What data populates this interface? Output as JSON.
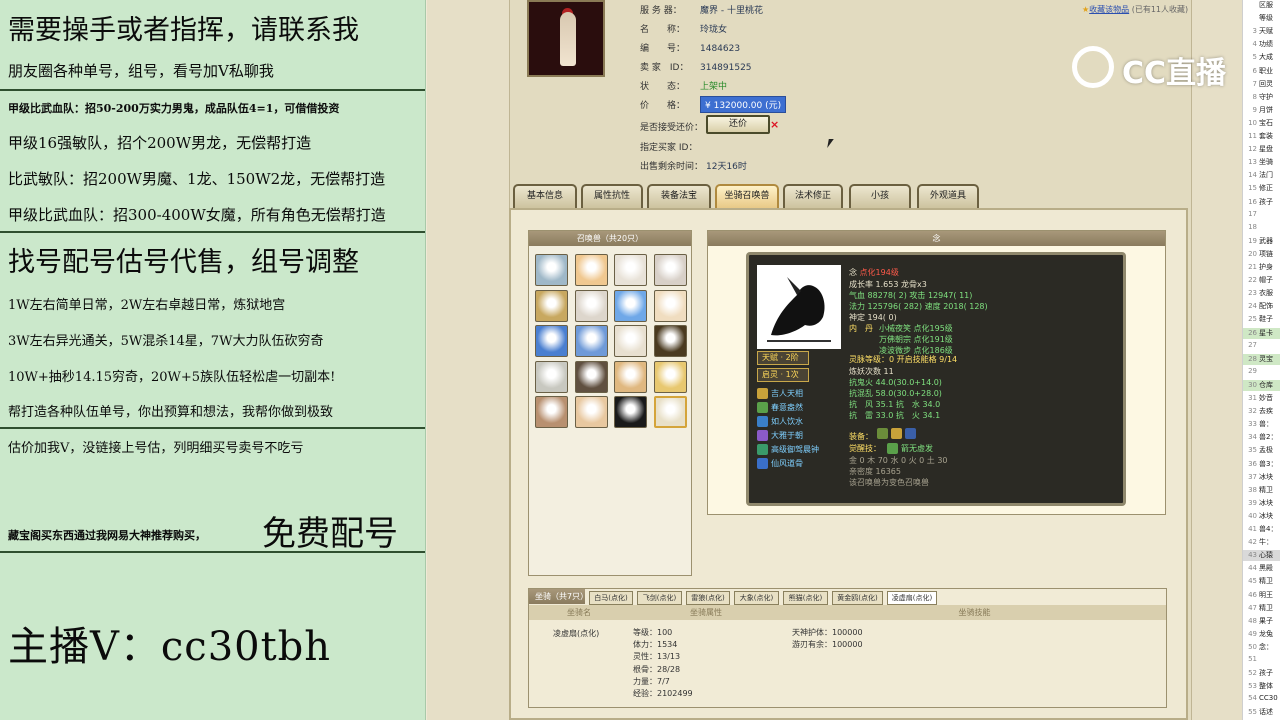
{
  "overlay": {
    "lines": [
      "需要操手或者指挥，请联系我",
      "朋友圈各种单号，组号，看号加V私聊我",
      "甲级比武血队：招50-200万实力男鬼，成品队伍4=1，可借借投资",
      "甲级16强敏队，招个200W男龙，无偿帮打造",
      "比武敏队：招200W男魔、1龙、150W2龙，无偿帮打造",
      "甲级比武血队：招300-400W女魔，所有角色无偿帮打造",
      "找号配号估号代售，组号调整",
      "1W左右简单日常，2W左右卓越日常，炼狱地宫",
      "3W左右异光通关，5W混杀14星，7W大力队伍砍穷奇",
      "10W+抽秒14.15穷奇，20W+5族队伍轻松虐一切副本!",
      "帮打造各种队伍单号，你出预算和想法，我帮你做到极致",
      "估价加我V，没链接上号估，列明细买号卖号不吃亏",
      "藏宝阁买东西通过我网易大神推荐购买，",
      "免费配号",
      "主播V：cc30tbh"
    ]
  },
  "listing": {
    "server_label": "服 务 器：",
    "server_value": "魔界 - 十里桃花",
    "name_label": "名　　称：",
    "name_value": "玲珑女",
    "id_label": "编　　号：",
    "id_value": "1484623",
    "seller_label": "卖 家　ID：",
    "seller_value": "314891525",
    "status_label": "状　　态：",
    "status_value": "上架中",
    "price_label": "价　　格：",
    "price_value": "¥ 132000.00 (元)",
    "counter_label": "是否接受还价：",
    "counter_button": "还价",
    "buyer_label": "指定买家 ID：",
    "time_label": "出售剩余时间：",
    "time_value": "12天16时",
    "fav_link": "收藏该物品",
    "fav_count": "(已有11人收藏)"
  },
  "tabs": [
    "基本信息",
    "属性抗性",
    "装备法宝",
    "坐骑召唤兽",
    "法术修正",
    "小孩",
    "外观道具"
  ],
  "pets": {
    "header": "召唤兽（共20只）",
    "panel_header": "念"
  },
  "pet_detail": {
    "name": "念",
    "name_tag": "点化194级",
    "growth": "成长率 1.653 龙骨x3",
    "hp": "气血 88278( 2) 攻击 12947( 11)",
    "mp": "法力 125796( 282) 速度 2018( 128)",
    "shen": "神定 194( 0)",
    "dan_label": "内　丹",
    "dan1": "小械夜笑 点化195级",
    "dan2": "万佛朝宗 点化191级",
    "dan3": "凌波微步 点化186级",
    "spirit": "灵脉等级：0 开启技能格 9/14",
    "refine": "炼妖次数 11",
    "res1": "抗鬼火 44.0(30.0+14.0)",
    "res2": "抗混乱 58.0(30.0+28.0)",
    "res3": "抗　风 35.1 抗　水 34.0",
    "res4": "抗　雷 33.0 抗　火 34.1",
    "badge1": "天赋 · 2阶",
    "badge2": "启灵 · 1次",
    "skills": [
      "吉人天相",
      "春意盎然",
      "如人饮水",
      "大雅于朝",
      "高级御驾晨钟",
      "仙风道骨"
    ],
    "equip_label": "装备：",
    "awaken_label": "觉醒技：",
    "awaken_value": "箭无虚发",
    "elements": "金 0 木 70 水 0 火 0 土 30",
    "intimacy": "亲密度 16365",
    "note": "该召唤兽为变色召唤兽"
  },
  "mount": {
    "header": "坐骑（共7只）",
    "tabs": [
      "白马(点化)",
      "飞剑(点化)",
      "雷狼(点化)",
      "大象(点化)",
      "熊猫(点化)",
      "黄金鸥(点化)",
      "凌虚扇(点化)"
    ],
    "col1": "坐骑名",
    "col2": "坐骑属性",
    "col3": "坐骑技能",
    "name": "凌虚扇(点化)",
    "stats": [
      "等级：100",
      "体力：1534",
      "灵性：13/13",
      "根骨：28/28",
      "力量：7/7",
      "经验：2102499"
    ],
    "skills": [
      "天神护体：100000",
      "游刃有余：100000"
    ]
  },
  "logo": "CC直播",
  "side_list": [
    {
      "n": "",
      "t": "区服"
    },
    {
      "n": "",
      "t": "等级"
    },
    {
      "n": "3",
      "t": "天赋"
    },
    {
      "n": "4",
      "t": "功绩"
    },
    {
      "n": "5",
      "t": "大成"
    },
    {
      "n": "6",
      "t": "职业"
    },
    {
      "n": "7",
      "t": "回灵"
    },
    {
      "n": "8",
      "t": "守护"
    },
    {
      "n": "9",
      "t": "月饼"
    },
    {
      "n": "10",
      "t": "宝石"
    },
    {
      "n": "11",
      "t": "套装"
    },
    {
      "n": "12",
      "t": "星盘"
    },
    {
      "n": "13",
      "t": "坐骑"
    },
    {
      "n": "14",
      "t": "法门"
    },
    {
      "n": "15",
      "t": "修正"
    },
    {
      "n": "16",
      "t": "孩子"
    },
    {
      "n": "17",
      "t": ""
    },
    {
      "n": "18",
      "t": ""
    },
    {
      "n": "19",
      "t": "武器"
    },
    {
      "n": "20",
      "t": "项链"
    },
    {
      "n": "21",
      "t": "护身"
    },
    {
      "n": "22",
      "t": "帽子"
    },
    {
      "n": "23",
      "t": "衣服"
    },
    {
      "n": "24",
      "t": "配饰"
    },
    {
      "n": "25",
      "t": "鞋子"
    },
    {
      "n": "26",
      "t": "星卡"
    },
    {
      "n": "27",
      "t": ""
    },
    {
      "n": "28",
      "t": "灵宝"
    },
    {
      "n": "29",
      "t": ""
    },
    {
      "n": "30",
      "t": "仓库"
    },
    {
      "n": "31",
      "t": "妙音"
    },
    {
      "n": "32",
      "t": "去疾"
    },
    {
      "n": "33",
      "t": "兽："
    },
    {
      "n": "34",
      "t": "兽2："
    },
    {
      "n": "35",
      "t": "孟极"
    },
    {
      "n": "36",
      "t": "兽3："
    },
    {
      "n": "37",
      "t": "冰块"
    },
    {
      "n": "38",
      "t": "精卫"
    },
    {
      "n": "39",
      "t": "冰块"
    },
    {
      "n": "40",
      "t": "冰块"
    },
    {
      "n": "41",
      "t": "兽4："
    },
    {
      "n": "42",
      "t": "牛："
    },
    {
      "n": "43",
      "t": "心猿"
    },
    {
      "n": "44",
      "t": "黑殿"
    },
    {
      "n": "45",
      "t": "精卫"
    },
    {
      "n": "46",
      "t": "明王"
    },
    {
      "n": "47",
      "t": "精卫"
    },
    {
      "n": "48",
      "t": "果子"
    },
    {
      "n": "49",
      "t": "龙兔"
    },
    {
      "n": "50",
      "t": "念："
    },
    {
      "n": "51",
      "t": ""
    },
    {
      "n": "52",
      "t": "孩子"
    },
    {
      "n": "53",
      "t": "整体"
    },
    {
      "n": "54",
      "t": "CC30"
    },
    {
      "n": "55",
      "t": "话述"
    }
  ]
}
